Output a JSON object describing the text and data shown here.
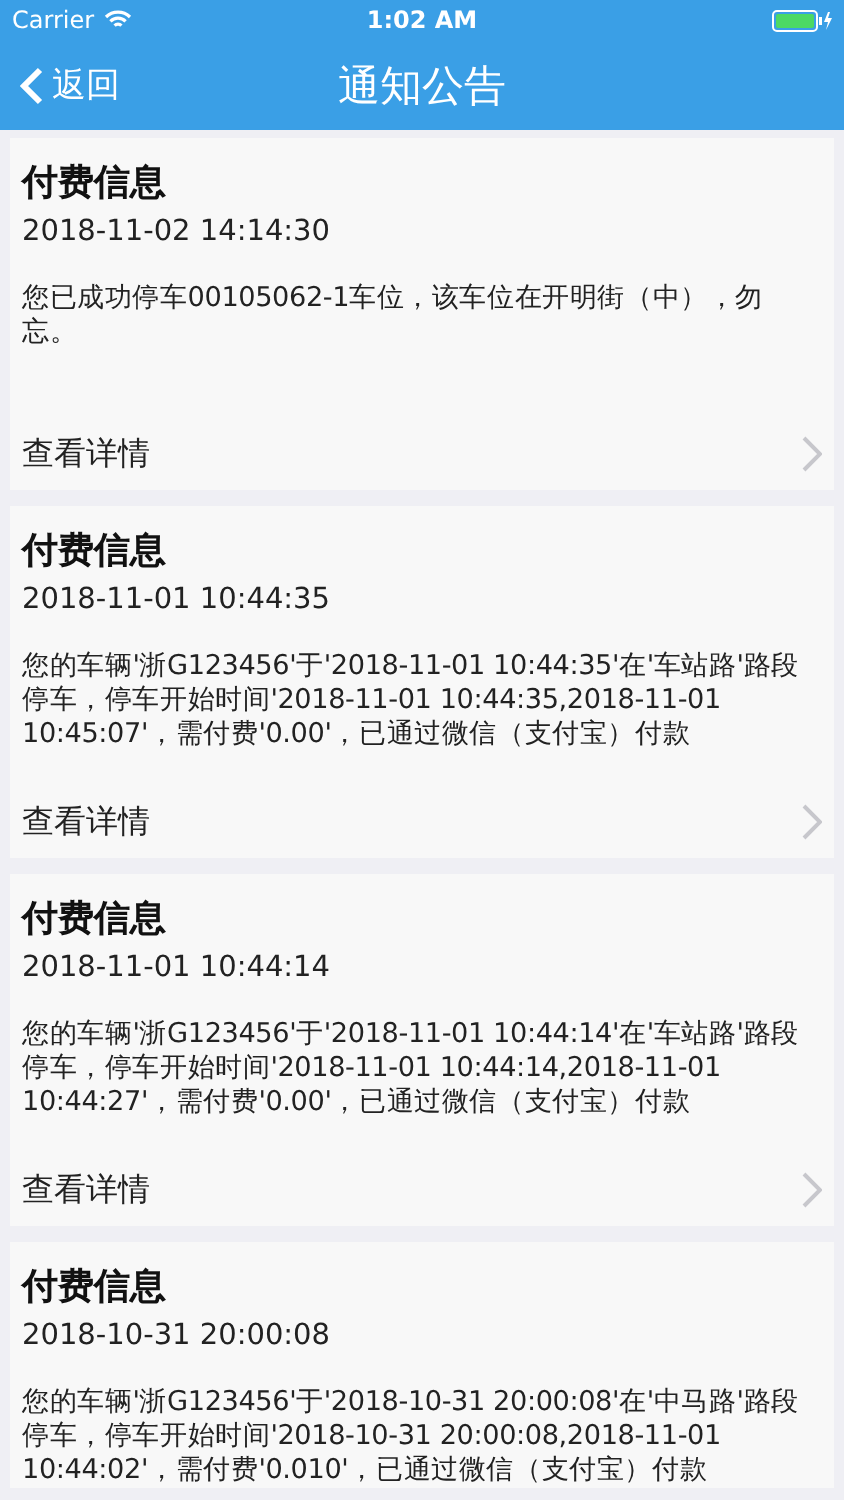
{
  "status_bar": {
    "carrier": "Carrier",
    "time": "1:02 AM"
  },
  "nav": {
    "back": "返回",
    "title": "通知公告"
  },
  "notices": [
    {
      "title": "付费信息",
      "date": "2018-11-02 14:14:30",
      "body": "您已成功停车00105062-1车位，该车位在开明街（中），勿忘。",
      "link": "查看详情"
    },
    {
      "title": "付费信息",
      "date": "2018-11-01 10:44:35",
      "body": "您的车辆'浙G123456'于'2018-11-01 10:44:35'在'车站路'路段停车，停车开始时间'2018-11-01 10:44:35,2018-11-01 10:45:07'，需付费'0.00'，已通过微信（支付宝）付款",
      "link": "查看详情"
    },
    {
      "title": "付费信息",
      "date": "2018-11-01 10:44:14",
      "body": "您的车辆'浙G123456'于'2018-11-01 10:44:14'在'车站路'路段停车，停车开始时间'2018-11-01 10:44:14,2018-11-01 10:44:27'，需付费'0.00'，已通过微信（支付宝）付款",
      "link": "查看详情"
    },
    {
      "title": "付费信息",
      "date": "2018-10-31 20:00:08",
      "body": "您的车辆'浙G123456'于'2018-10-31 20:00:08'在'中马路'路段停车，停车开始时间'2018-10-31 20:00:08,2018-11-01 10:44:02'，需付费'0.010'，已通过微信（支付宝）付款"
    }
  ]
}
